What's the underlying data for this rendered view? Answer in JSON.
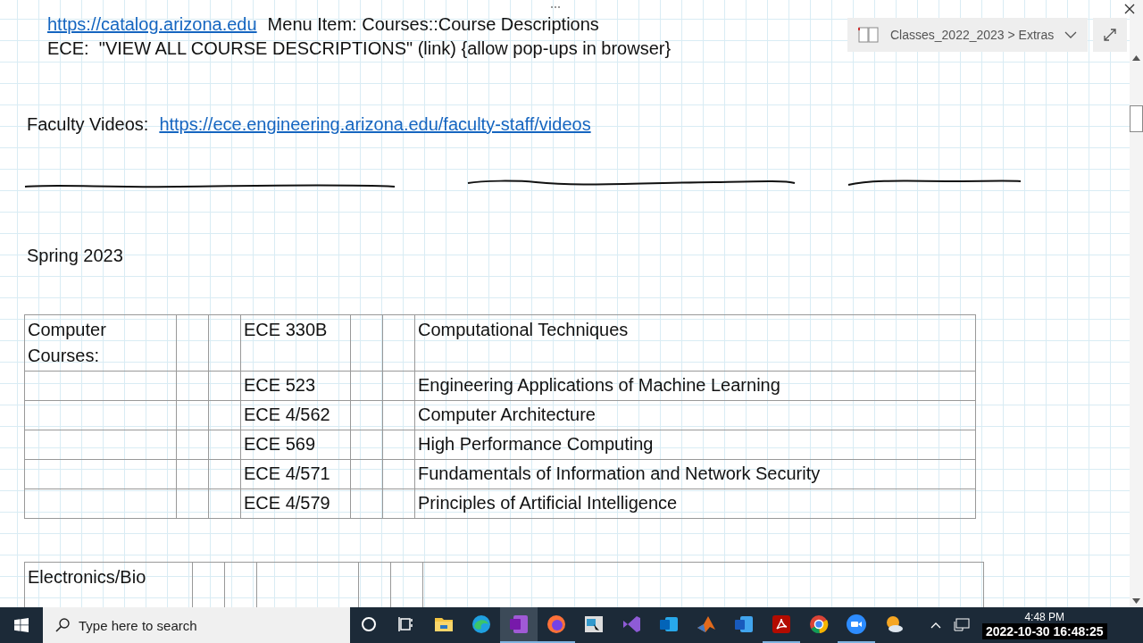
{
  "notebook": {
    "breadcrumb": "Classes_2022_2023 > Extras"
  },
  "notes": {
    "catalog_link": "https://catalog.arizona.edu",
    "catalog_text": "Menu Item: Courses::Course Descriptions",
    "ece_line": "ECE:  \"VIEW ALL COURSE DESCRIPTIONS\" (link) {allow pop-ups in browser}",
    "videos_label": "Faculty Videos:",
    "videos_link": "https://ece.engineering.arizona.edu/faculty-staff/videos",
    "term": "Spring 2023"
  },
  "tables": [
    {
      "rows": [
        {
          "label": "Computer Courses:",
          "code": "ECE 330B",
          "title": "Computational Techniques"
        },
        {
          "code": "ECE 523",
          "title": "Engineering Applications of Machine Learning"
        },
        {
          "code": "ECE 4/562",
          "title": "Computer Architecture"
        },
        {
          "code": "ECE 569",
          "title": "High Performance Computing"
        },
        {
          "code": "ECE 4/571",
          "title": "Fundamentals of Information and Network Security"
        },
        {
          "code": "ECE 4/579",
          "title": "Principles of Artificial Intelligence"
        }
      ]
    },
    {
      "rows": [
        {
          "label": "Electronics/Bio"
        }
      ]
    }
  ],
  "taskbar": {
    "search_placeholder": "Type here to search",
    "clock": "4:48 PM",
    "timestamp": "2022-10-30 16:48:25",
    "apps": [
      {
        "kind": "cortana",
        "selected": false,
        "running": false
      },
      {
        "kind": "taskview",
        "selected": false,
        "running": false
      },
      {
        "kind": "folder",
        "selected": false,
        "running": false
      },
      {
        "kind": "edge",
        "selected": false,
        "running": false
      },
      {
        "kind": "onenote",
        "selected": true,
        "running": true
      },
      {
        "kind": "firefox",
        "selected": false,
        "running": true
      },
      {
        "kind": "tool",
        "selected": false,
        "running": false
      },
      {
        "kind": "vstudio",
        "selected": false,
        "running": false
      },
      {
        "kind": "outlook",
        "selected": false,
        "running": false
      },
      {
        "kind": "matlab",
        "selected": false,
        "running": false
      },
      {
        "kind": "word",
        "selected": false,
        "running": false
      },
      {
        "kind": "pdf",
        "selected": false,
        "running": true
      },
      {
        "kind": "chrome",
        "selected": false,
        "running": false
      },
      {
        "kind": "zoom",
        "selected": false,
        "running": true
      },
      {
        "kind": "weather",
        "selected": false,
        "running": false
      }
    ]
  }
}
